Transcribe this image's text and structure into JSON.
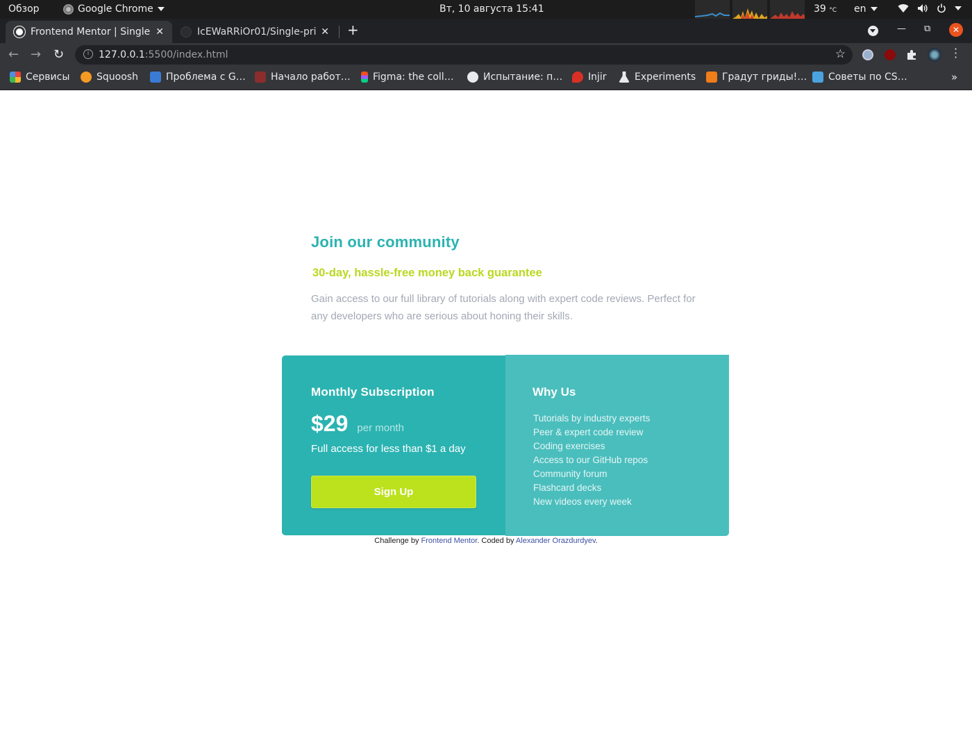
{
  "os_topbar": {
    "activities": "Обзор",
    "app_name": "Google Chrome",
    "clock": "Вт, 10 августа  15:41",
    "temperature": "39",
    "temperature_unit": "°C",
    "language": "en"
  },
  "browser": {
    "tabs": [
      {
        "title": "Frontend Mentor | Single",
        "active": true
      },
      {
        "title": "IcEWaRRiOr01/Single-pric",
        "active": false
      }
    ],
    "url_host": "127.0.0.1",
    "url_path": ":5500/index.html",
    "bookmarks": [
      {
        "label": "Сервисы",
        "icon": "apps-grid-icon",
        "color": "#e8453c"
      },
      {
        "label": "Squoosh",
        "icon": "squoosh-icon",
        "color": "#f59a23"
      },
      {
        "label": "Проблема с G…",
        "icon": "stackoverflow-icon",
        "color": "#3a7bd5"
      },
      {
        "label": "Начало работ…",
        "icon": "terminal-icon",
        "color": "#8b2d2d"
      },
      {
        "label": "Figma: the coll…",
        "icon": "figma-icon",
        "color": "#a259ff"
      },
      {
        "label": "Испытание: п…",
        "icon": "globe-icon",
        "color": "#e8eaed"
      },
      {
        "label": "Injir",
        "icon": "injir-icon",
        "color": "#d93025"
      },
      {
        "label": "Experiments",
        "icon": "flask-icon",
        "color": "#e8eaed"
      },
      {
        "label": "Градут гриды!…",
        "icon": "dots-icon",
        "color": "#f07c1a"
      },
      {
        "label": "Советы по CS…",
        "icon": "css-tips-icon",
        "color": "#4aa3df"
      }
    ]
  },
  "page": {
    "heading": "Join our community",
    "subheading": "30-day, hassle-free money back guarantee",
    "description": "Gain access to our full library of tutorials along with expert code reviews. Perfect for any developers who are serious about honing their skills.",
    "subscription": {
      "title": "Monthly Subscription",
      "price": "$29",
      "per": "per month",
      "access": "Full access for less than $1 a day",
      "button": "Sign Up"
    },
    "why_us": {
      "title": "Why Us",
      "items": [
        "Tutorials by industry experts",
        "Peer & expert code review",
        "Coding exercises",
        "Access to our GitHub repos",
        "Community forum",
        "Flashcard decks",
        "New videos every week"
      ]
    },
    "attribution": {
      "prefix": "Challenge by ",
      "link1": "Frontend Mentor",
      "middle": ". Coded by ",
      "link2": "Alexander Orazdurdyev",
      "suffix": "."
    },
    "colors": {
      "cyan": "#2bb3b1",
      "light_cyan": "#4abebd",
      "lime": "#bbe21d",
      "grey_text": "#a3a8b4"
    }
  }
}
